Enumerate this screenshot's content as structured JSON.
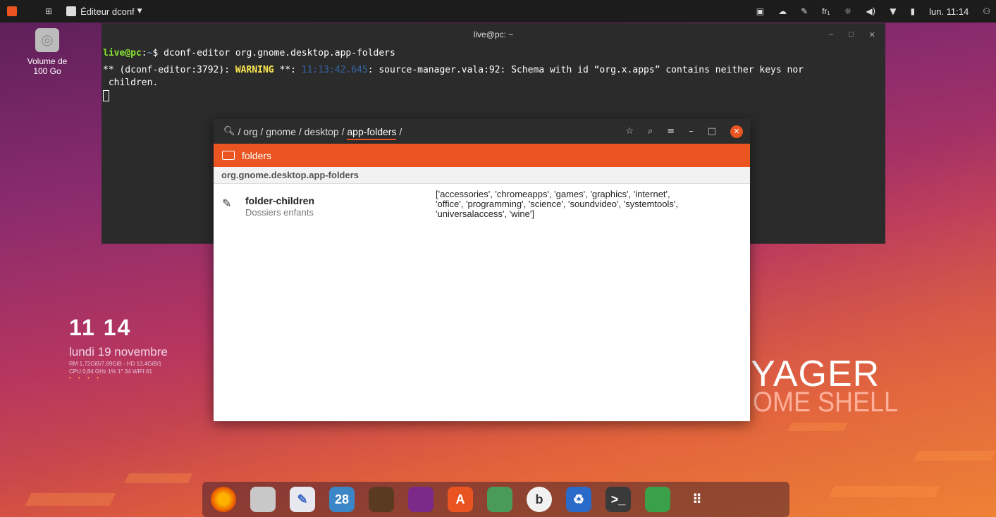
{
  "topbar": {
    "app_name": "Éditeur dconf",
    "tray": {
      "lang": "fr₁",
      "clock": "lun. 11:14"
    }
  },
  "desktop": {
    "volume_label_line1": "Volume de",
    "volume_label_line2": "100 Go",
    "widget": {
      "time": "11 14",
      "date": "lundi 19 novembre",
      "sys_line1": "RM 1,72GiB/7,69GiB - HD 13,4GiB/1",
      "sys_line2": "CPU 0,84 GHz 1% 1° 34  WIFI 61",
      "dots": "• • • •"
    },
    "brand_title": "YAGER",
    "brand_sub": "OME SHELL"
  },
  "terminal": {
    "title": "live@pc: ~",
    "prompt_user": "live@pc",
    "prompt_sep": ":",
    "prompt_path": "~",
    "prompt_symbol": "$ ",
    "command": "dconf-editor org.gnome.desktop.app-folders",
    "warn_prefix": "** (dconf-editor:3792): ",
    "warn_word": "WARNING",
    "warn_mid": " **: ",
    "warn_ts": "11:13:42.645",
    "warn_msg": ": source-manager.vala:92: Schema with id “org.x.apps” contains neither keys nor",
    "warn_msg2": " children."
  },
  "dconf": {
    "breadcrumb_prefix": "/ org / gnome / desktop / ",
    "breadcrumb_current": "app-folders",
    "breadcrumb_suffix": " /",
    "folder_label": "folders",
    "schema": "org.gnome.desktop.app-folders",
    "key": {
      "name": "folder-children",
      "description": "Dossiers enfants",
      "value_line1": "['accessories', 'chromeapps', 'games', 'graphics', 'internet',",
      "value_line2": "'office', 'programming', 'science', 'soundvideo', 'systemtools',",
      "value_line3": "'universalaccess', 'wine']"
    }
  },
  "dock": {
    "calendar_day": "28"
  },
  "colors": {
    "accent": "#e95420",
    "panel": "#1c1c1c",
    "terminal_bg": "#2b2b2b"
  }
}
